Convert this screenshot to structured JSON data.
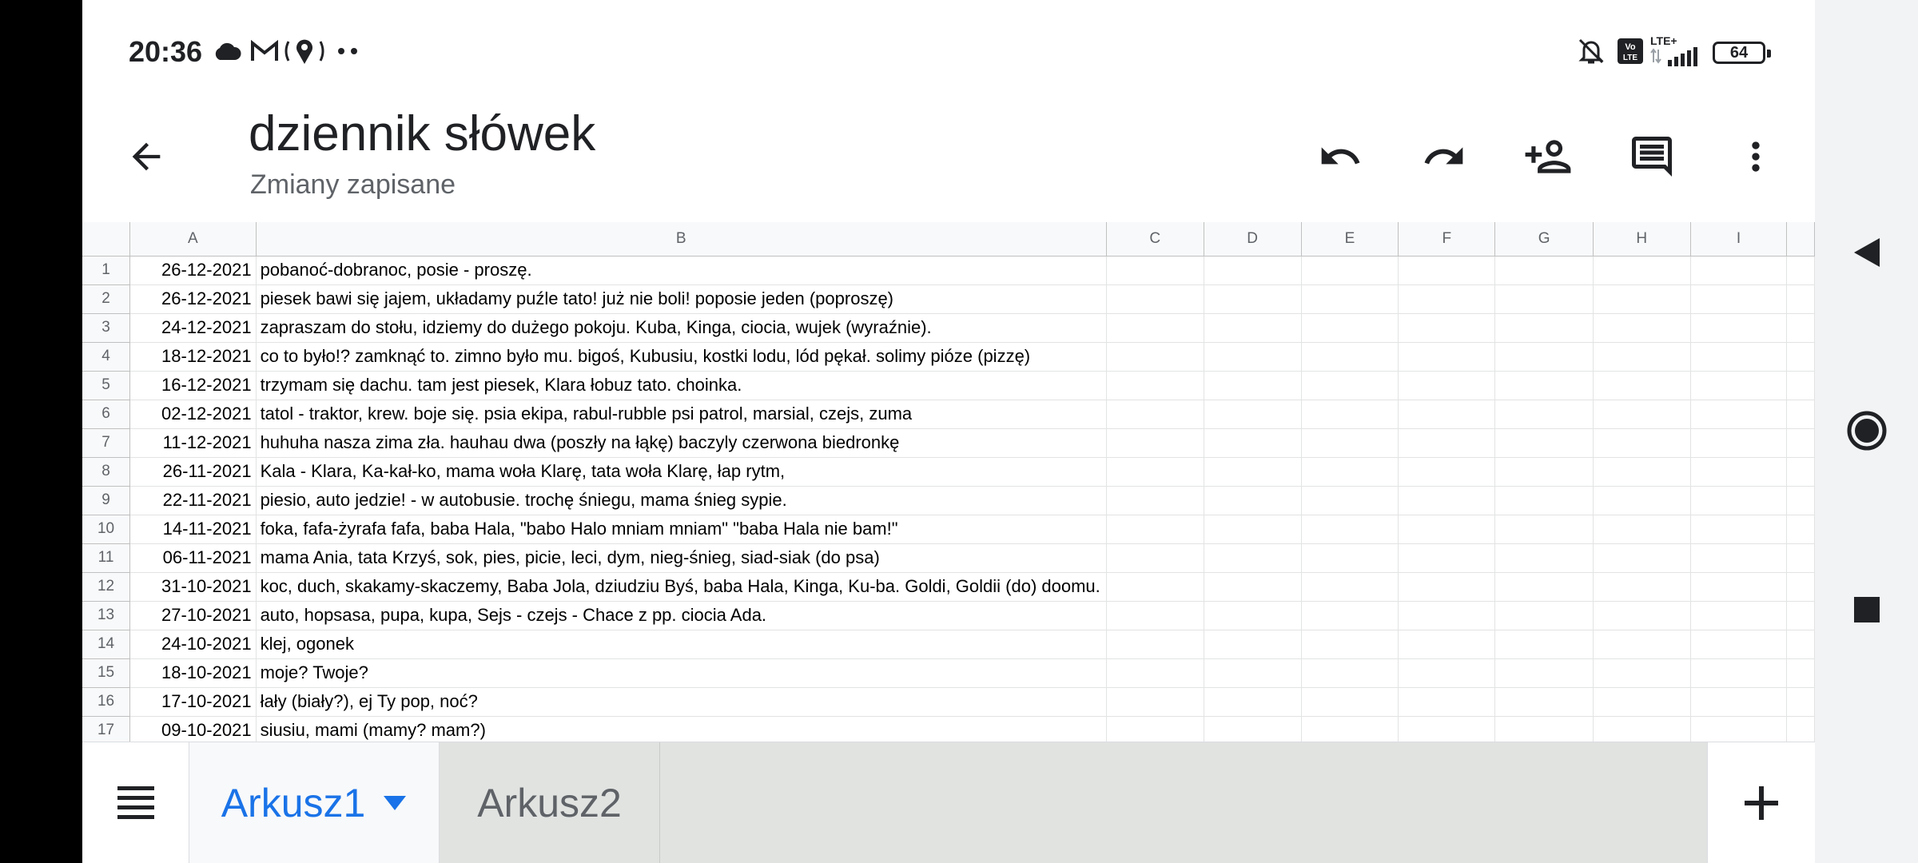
{
  "status_bar": {
    "time": "20:36",
    "left_icons": [
      "cloud-icon",
      "gmail-icon",
      "location-icon",
      "more-dots-icon"
    ],
    "right_icons": [
      "mute-icon",
      "volte-icon",
      "lte-signal-icon"
    ],
    "lte_label": "LTE+",
    "volte_label": "Vo LTE",
    "battery": "64"
  },
  "toolbar": {
    "title": "dziennik słówek",
    "status": "Zmiany zapisane",
    "buttons": [
      "back-icon",
      "undo-icon",
      "redo-icon",
      "share-icon",
      "comment-icon",
      "more-vert-icon"
    ]
  },
  "grid": {
    "columns": [
      "A",
      "B",
      "C",
      "D",
      "E",
      "F",
      "G",
      "H",
      "I"
    ],
    "rows": [
      {
        "n": "1",
        "a": "26-12-2021",
        "b": "pobanoć-dobranoc, posie - proszę."
      },
      {
        "n": "2",
        "a": "26-12-2021",
        "b": " piesek bawi się jajem, układamy puźle tato! już nie boli! poposie jeden (poproszę)"
      },
      {
        "n": "3",
        "a": "24-12-2021",
        "b": "zapraszam do stołu, idziemy do dużego pokoju. Kuba, Kinga, ciocia, wujek (wyraźnie)."
      },
      {
        "n": "4",
        "a": "18-12-2021",
        "b": "co to było!? zamknąć to. zimno było mu. bigoś, Kubusiu, kostki lodu, lód pękał. solimy pióze (pizzę)"
      },
      {
        "n": "5",
        "a": "16-12-2021",
        "b": "trzymam się dachu. tam jest piesek, Klara łobuz tato. choinka."
      },
      {
        "n": "6",
        "a": "02-12-2021",
        "b": "tatol - traktor, krew. boje się. psia ekipa, rabul-rubble psi patrol, marsial, czejs, zuma"
      },
      {
        "n": "7",
        "a": "11-12-2021",
        "b": "huhuha nasza zima zła. hauhau dwa (poszły na łąkę) baczyly czerwona biedronkę"
      },
      {
        "n": "8",
        "a": "26-11-2021",
        "b": "Kala - Klara, Ka-kał-ko, mama woła Klarę, tata woła Klarę, łap rytm,"
      },
      {
        "n": "9",
        "a": "22-11-2021",
        "b": "piesio, auto jedzie! - w autobusie. trochę śniegu, mama śnieg sypie."
      },
      {
        "n": "10",
        "a": "14-11-2021",
        "b": "foka, fafa-żyrafa fafa, baba Hala, \"babo Halo mniam mniam\" \"baba Hala nie bam!\""
      },
      {
        "n": "11",
        "a": "06-11-2021",
        "b": "mama Ania, tata Krzyś, sok, pies, picie, leci, dym, nieg-śnieg, siad-siak (do psa)"
      },
      {
        "n": "12",
        "a": "31-10-2021",
        "b": "koc, duch, skakamy-skaczemy, Baba Jola, dziudziu Byś, baba Hala, Kinga, Ku-ba. Goldi, Goldii (do) doomu."
      },
      {
        "n": "13",
        "a": "27-10-2021",
        "b": "auto, hopsasa, pupa, kupa, Sejs - czejs - Chace z pp. ciocia Ada."
      },
      {
        "n": "14",
        "a": "24-10-2021",
        "b": "klej, ogonek"
      },
      {
        "n": "15",
        "a": "18-10-2021",
        "b": "moje? Twoje?"
      },
      {
        "n": "16",
        "a": "17-10-2021",
        "b": "łały (biały?), ej Ty pop, noć?"
      },
      {
        "n": "17",
        "a": "09-10-2021",
        "b": "siusiu, mami (mamy? mam?)"
      }
    ]
  },
  "sheets": {
    "tabs": [
      {
        "label": "Arkusz1",
        "active": true
      },
      {
        "label": "Arkusz2",
        "active": false
      }
    ],
    "menu_icon": "list-icon",
    "add_icon": "plus-icon"
  },
  "nav": [
    "back-triangle-icon",
    "home-circle-icon",
    "recents-square-icon"
  ],
  "colors": {
    "accent": "#1a73e8",
    "text": "#202124",
    "secondary": "#5f6368",
    "header_bg": "#f8f9fa",
    "grid_line": "#e2e3e3"
  }
}
